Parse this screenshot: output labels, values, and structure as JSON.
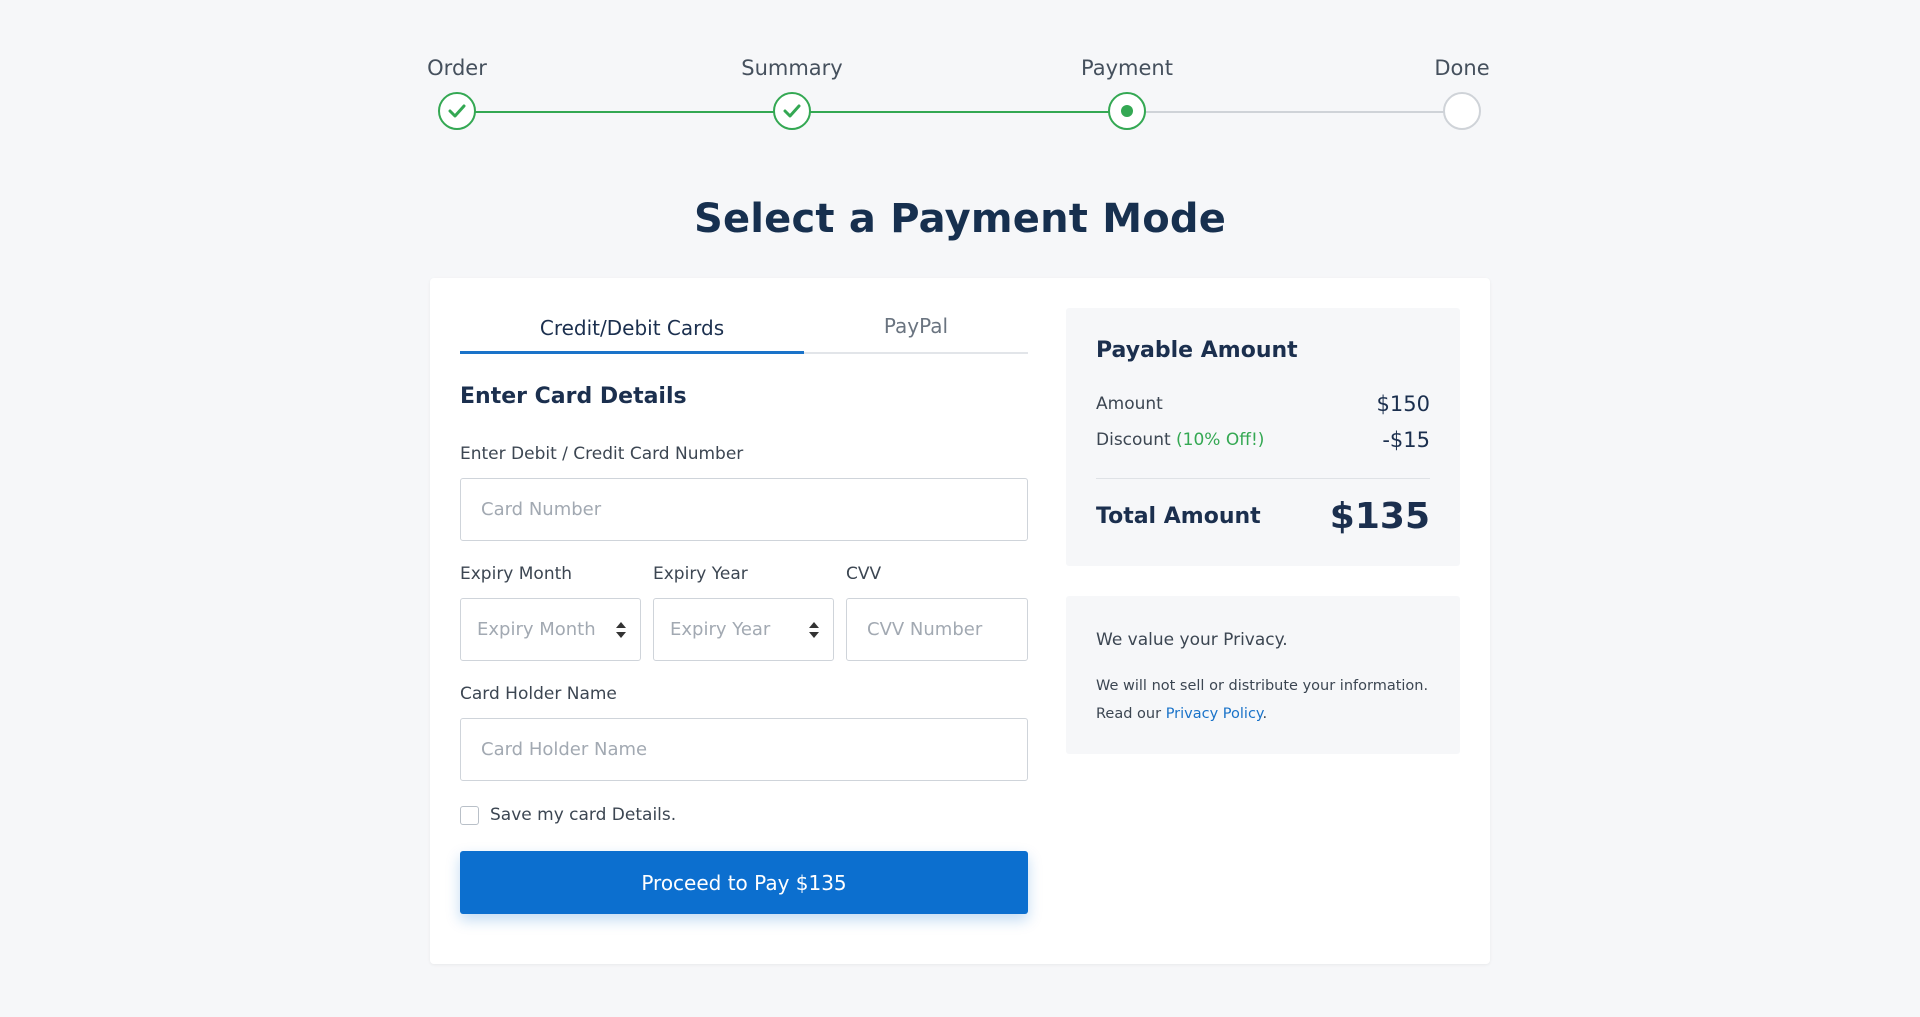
{
  "stepper": {
    "steps": [
      {
        "label": "Order",
        "state": "complete"
      },
      {
        "label": "Summary",
        "state": "complete"
      },
      {
        "label": "Payment",
        "state": "current"
      },
      {
        "label": "Done",
        "state": "pending"
      }
    ]
  },
  "page_title": "Select a Payment Mode",
  "tabs": {
    "card": "Credit/Debit Cards",
    "paypal": "PayPal"
  },
  "form": {
    "section_title": "Enter Card Details",
    "card_number_label": "Enter Debit / Credit Card Number",
    "card_number_placeholder": "Card Number",
    "expiry_month_label": "Expiry Month",
    "expiry_month_value": "Expiry Month",
    "expiry_year_label": "Expiry Year",
    "expiry_year_value": "Expiry Year",
    "cvv_label": "CVV",
    "cvv_placeholder": "CVV Number",
    "holder_label": "Card Holder Name",
    "holder_placeholder": "Card Holder Name",
    "save_card_label": "Save my card Details.",
    "save_card_checked": false,
    "pay_button": "Proceed to Pay $135"
  },
  "summary": {
    "title": "Payable Amount",
    "amount_label": "Amount",
    "amount_value": "$150",
    "discount_label": "Discount",
    "discount_tag": "(10% Off!)",
    "discount_value": "-$15",
    "total_label": "Total Amount",
    "total_value": "$135"
  },
  "privacy": {
    "title": "We value your Privacy.",
    "text": "We will not sell or distribute your information. Read our",
    "link": "Privacy Policy",
    "suffix": "."
  },
  "colors": {
    "accent": "#0c6fcf",
    "success": "#34a853",
    "heading": "#17304f"
  }
}
